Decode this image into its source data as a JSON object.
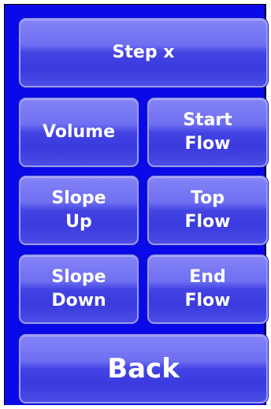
{
  "panel": {
    "background_color": "#0a0ae8",
    "button_color": "#4444e4",
    "text_color": "#ffffff"
  },
  "buttons": {
    "step": "Step x",
    "volume": "Volume",
    "start_flow": "Start\nFlow",
    "slope_up": "Slope\nUp",
    "top_flow": "Top\nFlow",
    "slope_down": "Slope\nDown",
    "end_flow": "End\nFlow",
    "back": "Back"
  }
}
